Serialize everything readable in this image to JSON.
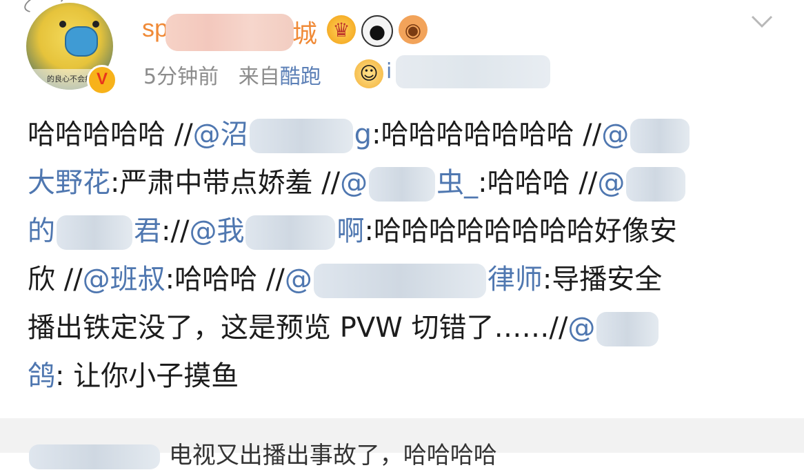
{
  "post": {
    "username_prefix": "sp",
    "username_suffix": "城",
    "avatar_caption": "的良心不会痛",
    "verified_badge": "V",
    "badges": [
      "crown-icon",
      "panda-icon",
      "fish-icon"
    ],
    "time": "5分钟前",
    "source_prefix": "来自",
    "source_app": "酷跑",
    "source_tail": "i",
    "body_lines": [
      {
        "a": "哈哈哈哈哈 //",
        "m1": "@",
        "m1b": "沼",
        "m1c": "g",
        "b": ":哈哈哈哈哈哈哈 //",
        "m2": "@"
      },
      {
        "m": "大野花",
        "t": ":严肃中带点娇羞 //",
        "m2": "@",
        "m2c": "虫_",
        "t2": ":哈哈哈 //",
        "m3": "@"
      },
      {
        "m": "的",
        "m2": "君",
        "t": "://",
        "m3": "@我",
        "m3c": "啊",
        "t2": ":哈哈哈哈哈哈哈哈好像安"
      },
      {
        "t": "欣 //",
        "m": "@班叔",
        "t2": ":哈哈哈 //",
        "m2": "@",
        "m2c": "律师",
        "t3": ":导播安全"
      },
      {
        "t": "播出铁定没了，这是预览 PVW 切错了……//",
        "m": "@"
      },
      {
        "m": "鸽",
        "t": ": 让你小子摸鱼"
      }
    ]
  },
  "repost": {
    "text": "电视又出播出事故了，哈哈哈哈"
  },
  "colors": {
    "username": "#f08a37",
    "mention": "#4f77b0",
    "meta": "#8c8c8c",
    "repost_bg": "#f2f2f2"
  }
}
